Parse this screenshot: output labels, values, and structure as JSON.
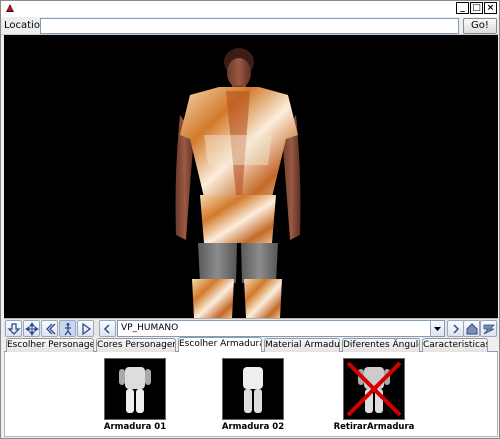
{
  "window": {
    "icon": "duke-icon",
    "controls": [
      "minimize-icon",
      "maximize-icon",
      "close-icon"
    ]
  },
  "location": {
    "label": "Location:",
    "value": "",
    "go_label": "Go!"
  },
  "navigation": {
    "buttons": [
      "down-arrow-icon",
      "pan-icon",
      "back-icon",
      "walk-icon",
      "play-icon",
      "previous-viewpoint-icon"
    ],
    "viewpoint": "VP_HUMANO",
    "right_buttons": [
      "next-viewpoint-icon",
      "home-icon",
      "straighten-icon"
    ]
  },
  "tabs": [
    {
      "label": "Escolher Personagem",
      "active": false
    },
    {
      "label": "Cores Personagem",
      "active": false
    },
    {
      "label": "Escolher Armadura",
      "active": true
    },
    {
      "label": "Material Armadura",
      "active": false
    },
    {
      "label": "Diferentes Ângulos",
      "active": false
    },
    {
      "label": "Caracteristicas",
      "active": false
    }
  ],
  "armors": [
    {
      "label": "Armadura 01"
    },
    {
      "label": "Armadura 02"
    },
    {
      "label": "RetirarArmadura"
    }
  ],
  "colors": {
    "viewport_bg": "#000000",
    "armor_gold": "#d8924a",
    "pants_gray": "#7a7a7a",
    "remove_x": "#d40000"
  }
}
